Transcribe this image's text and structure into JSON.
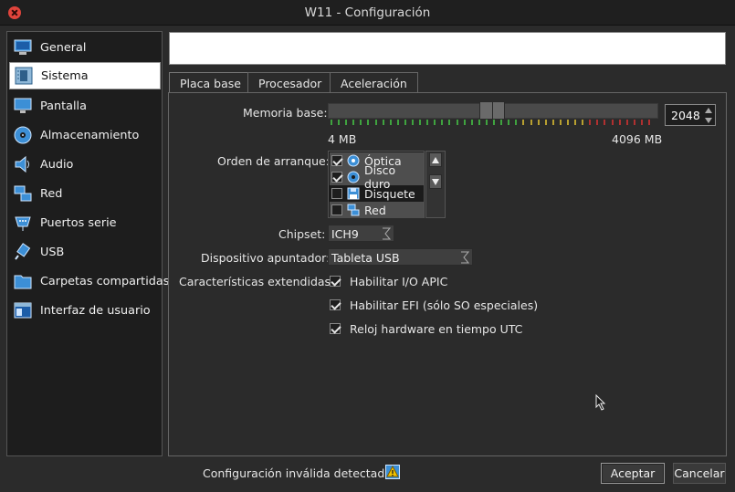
{
  "window": {
    "title": "W11 - Configuración"
  },
  "sidebar": {
    "items": [
      {
        "label": "General",
        "icon": "general-icon",
        "selected": false
      },
      {
        "label": "Sistema",
        "icon": "motherboard-icon",
        "selected": true
      },
      {
        "label": "Pantalla",
        "icon": "monitor-icon",
        "selected": false
      },
      {
        "label": "Almacenamiento",
        "icon": "disk-icon",
        "selected": false
      },
      {
        "label": "Audio",
        "icon": "speaker-icon",
        "selected": false
      },
      {
        "label": "Red",
        "icon": "network-icon",
        "selected": false
      },
      {
        "label": "Puertos serie",
        "icon": "serial-port-icon",
        "selected": false
      },
      {
        "label": "USB",
        "icon": "usb-icon",
        "selected": false
      },
      {
        "label": "Carpetas compartidas",
        "icon": "folder-icon",
        "selected": false
      },
      {
        "label": "Interfaz de usuario",
        "icon": "window-icon",
        "selected": false
      }
    ]
  },
  "tabs": [
    {
      "label": "Placa base",
      "active": true
    },
    {
      "label": "Procesador",
      "active": false
    },
    {
      "label": "Aceleración",
      "active": false
    }
  ],
  "motherboard": {
    "memory_label": "Memoria base:",
    "memory_value": "2048",
    "memory_min": "4 MB",
    "memory_max": "4096 MB",
    "boot_order_label": "Orden de arranque:",
    "boot_order": [
      {
        "name": "Óptica",
        "checked": true,
        "icon": "optical-disc-icon"
      },
      {
        "name": "Disco duro",
        "checked": true,
        "icon": "hard-disk-icon"
      },
      {
        "name": "Disquete",
        "checked": false,
        "icon": "floppy-icon"
      },
      {
        "name": "Red",
        "checked": false,
        "icon": "network-icon"
      }
    ],
    "chipset_label": "Chipset:",
    "chipset_value": "ICH9",
    "pointer_label": "Dispositivo apuntador:",
    "pointer_value": "Tableta USB",
    "extended_label": "Características extendidas:",
    "extended": [
      {
        "label": "Habilitar I/O APIC",
        "checked": true
      },
      {
        "label": "Habilitar EFI (sólo SO especiales)",
        "checked": true
      },
      {
        "label": "Reloj hardware en tiempo UTC",
        "checked": true
      }
    ]
  },
  "footer": {
    "message": "Configuración inválida detectada",
    "accept": "Aceptar",
    "cancel": "Cancelar"
  },
  "colors": {
    "tick_green": "#3fa33f",
    "tick_yellow": "#b8a030",
    "tick_red": "#b03030"
  }
}
